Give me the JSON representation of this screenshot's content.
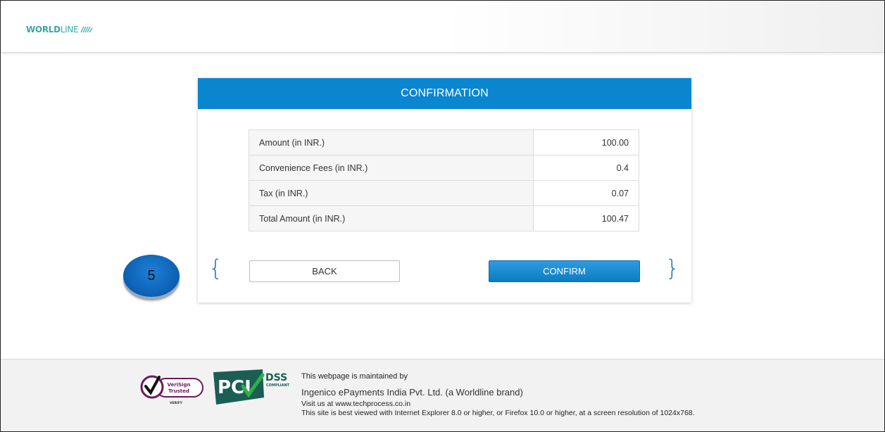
{
  "header": {
    "logo_bold": "WORLD",
    "logo_light": "LINE"
  },
  "card": {
    "title": "CONFIRMATION",
    "rows": [
      {
        "label": "Amount (in INR.)",
        "value": "100.00"
      },
      {
        "label": "Convenience Fees (in INR.)",
        "value": "0.4"
      },
      {
        "label": "Tax (in INR.)",
        "value": "0.07"
      },
      {
        "label": "Total Amount (in INR.)",
        "value": "100.47"
      }
    ],
    "back_label": "BACK",
    "confirm_label": "CONFIRM",
    "brace_left": "{",
    "brace_right": "}"
  },
  "step_badge": {
    "number": "5"
  },
  "footer": {
    "badges": {
      "verisign_line1": "VeriSign",
      "verisign_line2": "Trusted",
      "verisign_line3": "VERIFY",
      "pci_text": "PCI",
      "dss_text": "DSS",
      "compliant_text": "COMPLIANT"
    },
    "maintained_by": "This webpage is maintained by",
    "company": "Ingenico ePayments India Pvt. Ltd. (a Worldline brand)",
    "visit": "Visit us at www.techprocess.co.in",
    "best_viewed": "This site is best viewed with Internet Explorer 8.0 or higher, or Firefox 10.0 or higher, at a screen resolution of 1024x768."
  },
  "colors": {
    "brand_teal": "#3aa8a0",
    "primary_blue": "#0a86d1",
    "badge_blue": "#0b5fb2"
  }
}
